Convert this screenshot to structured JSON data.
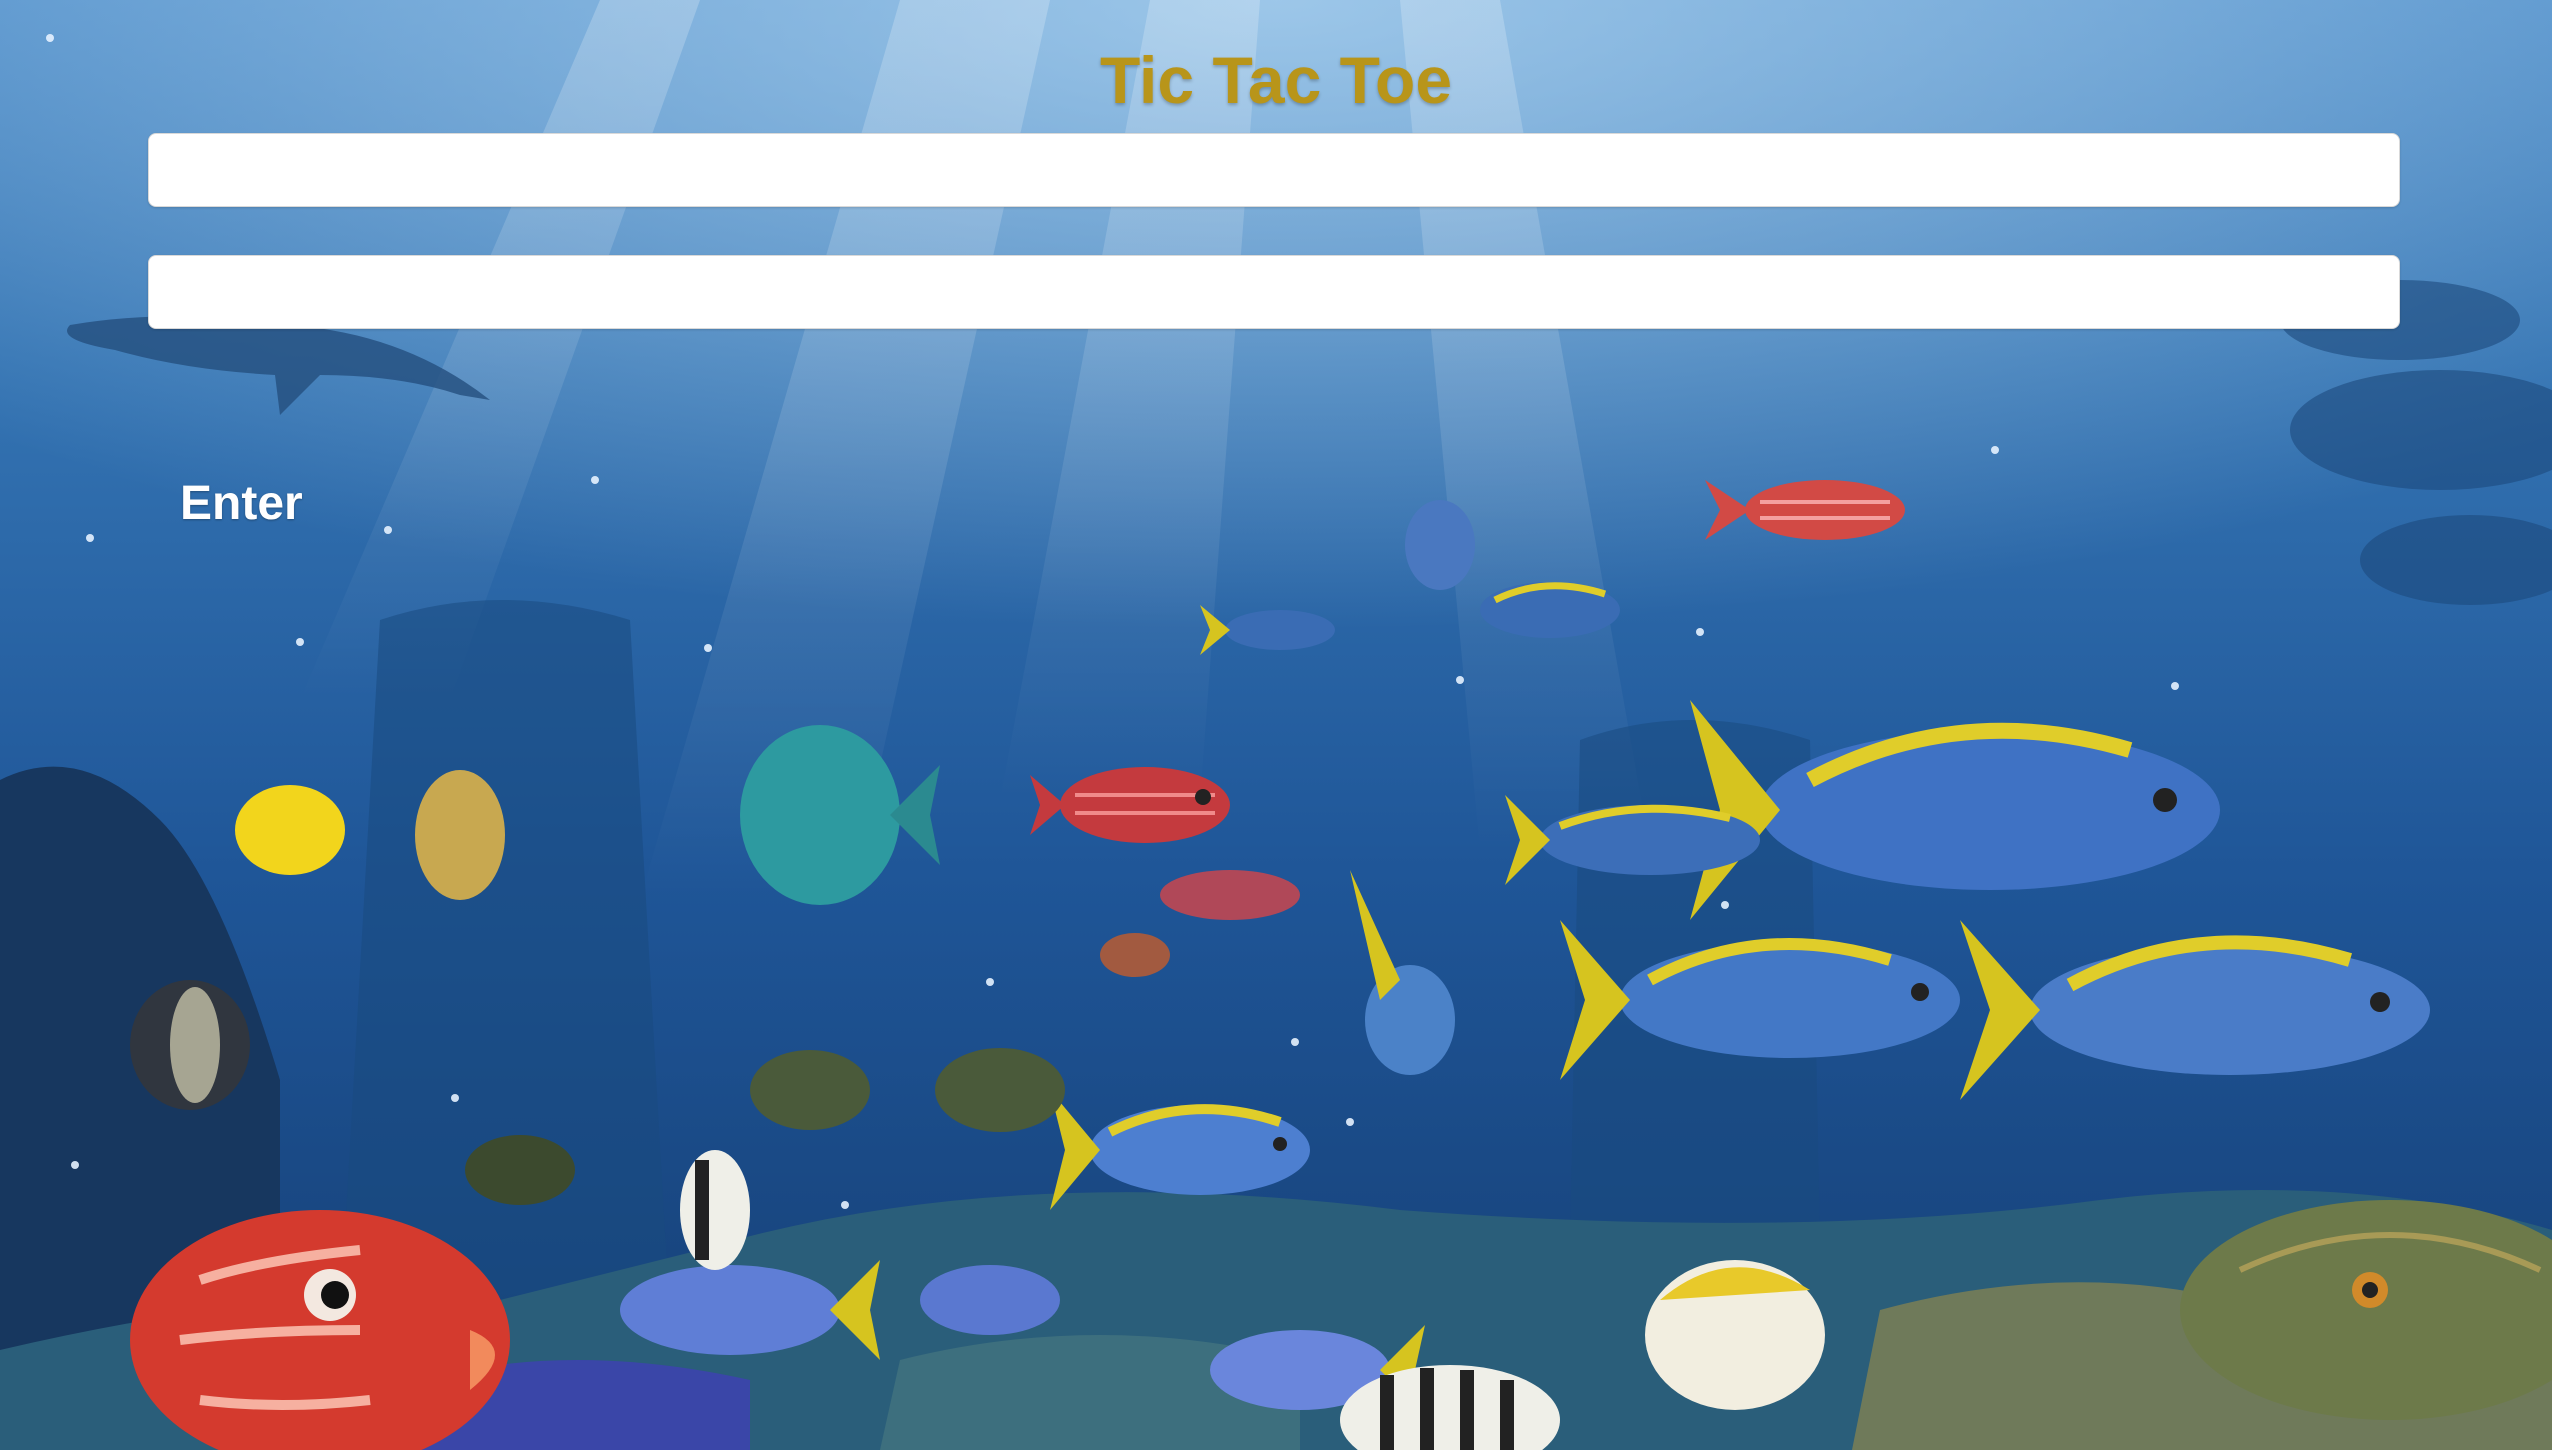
{
  "page": {
    "title": "Tic Tac Toe",
    "title_color": "#b8951a"
  },
  "form": {
    "field_1_value": "",
    "field_1_placeholder": "",
    "field_2_value": "",
    "field_2_placeholder": "",
    "enter_label": "Enter"
  },
  "background": {
    "scene": "underwater-aquarium",
    "colors": [
      "#5b94c9",
      "#2d6aa8",
      "#1c4f8c",
      "#163d70"
    ]
  }
}
